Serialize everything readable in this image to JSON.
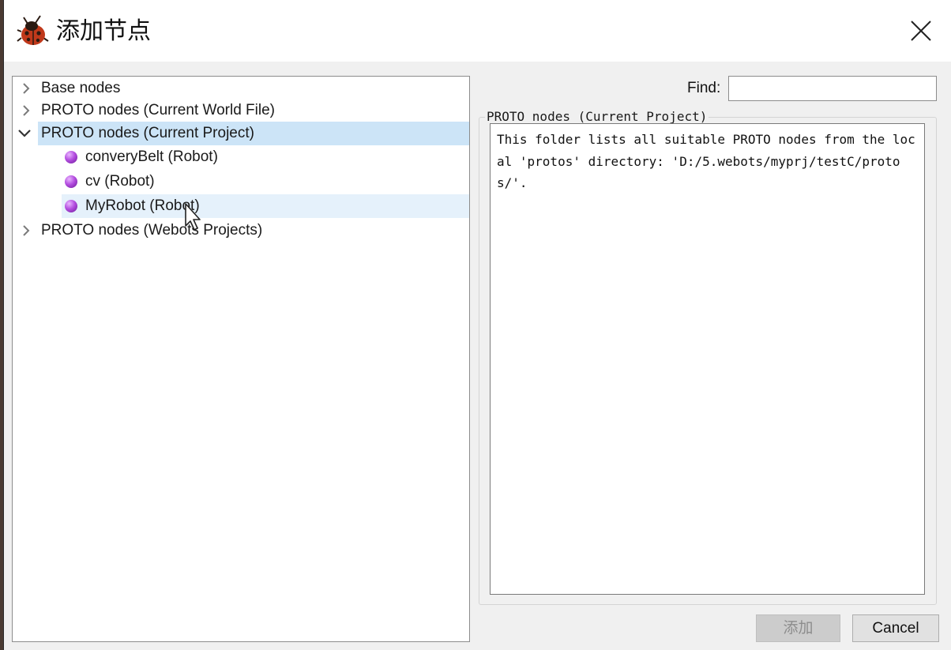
{
  "window": {
    "title": "添加节点",
    "icon": "ladybug-icon",
    "close_icon": "close-icon"
  },
  "tree": {
    "items": [
      {
        "label": "Base nodes",
        "expanded": false,
        "state": "normal"
      },
      {
        "label": "PROTO nodes (Current World File)",
        "expanded": false,
        "state": "normal"
      },
      {
        "label": "PROTO nodes (Current Project)",
        "expanded": true,
        "state": "selected",
        "children": [
          {
            "label": "converyBelt (Robot)",
            "icon": "proto-node-icon",
            "state": "normal"
          },
          {
            "label": "cv (Robot)",
            "icon": "proto-node-icon",
            "state": "normal"
          },
          {
            "label": "MyRobot (Robot)",
            "icon": "proto-node-icon",
            "state": "hover"
          }
        ]
      },
      {
        "label": "PROTO nodes (Webots Projects)",
        "expanded": false,
        "state": "normal"
      }
    ]
  },
  "find": {
    "label": "Find:",
    "value": ""
  },
  "info": {
    "group_title": "PROTO nodes (Current Project)",
    "description": "This folder lists all suitable PROTO nodes from the local 'protos' directory: 'D:/5.webots/myprj/testC/protos/'."
  },
  "buttons": {
    "add_label": "添加",
    "add_enabled": false,
    "cancel_label": "Cancel"
  },
  "colors": {
    "selection": "#cce4f7",
    "hover": "#e5f1fb",
    "proto_node": "#b44ee0"
  }
}
